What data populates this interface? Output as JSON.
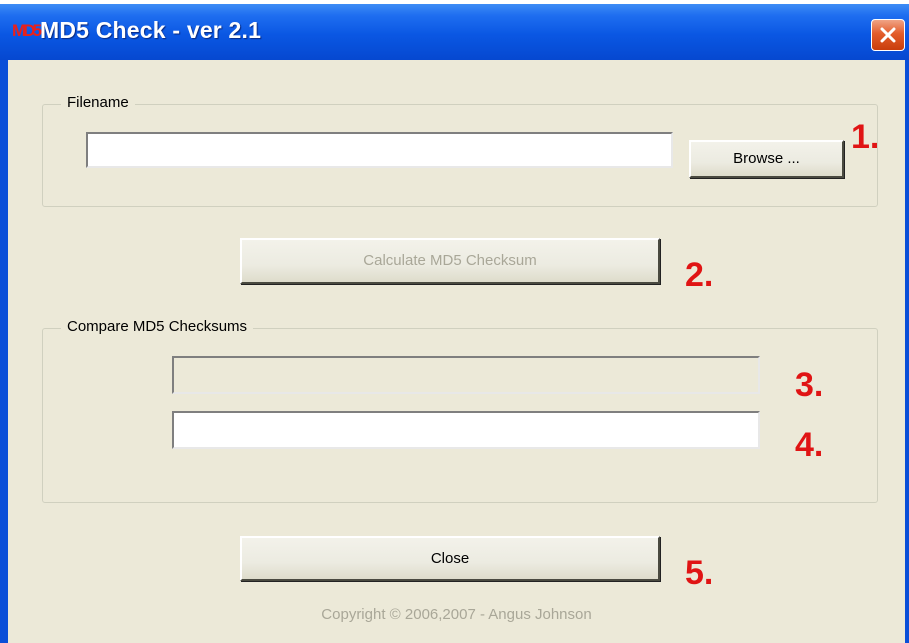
{
  "window": {
    "title": "MD5 Check - ver 2.1",
    "icon_text": "MD5",
    "icon": "md5-app-icon",
    "close_icon": "close-icon"
  },
  "filename_group": {
    "label": "Filename",
    "filename_value": "",
    "browse_label": "Browse ..."
  },
  "calculate_button": {
    "label": "Calculate MD5 Checksum",
    "enabled": false
  },
  "compare_group": {
    "label": "Compare MD5 Checksums",
    "computed_value": "",
    "compare_value": ""
  },
  "close_button": {
    "label": "Close"
  },
  "copyright": "Copyright © 2006,2007 - Angus Johnson",
  "annotations": [
    "1.",
    "2.",
    "3.",
    "4.",
    "5."
  ],
  "colors": {
    "titlebar": "#0a57e3",
    "dialog_bg": "#ece9d8",
    "annotation": "#e01414",
    "close_button": "#e35d2b"
  }
}
